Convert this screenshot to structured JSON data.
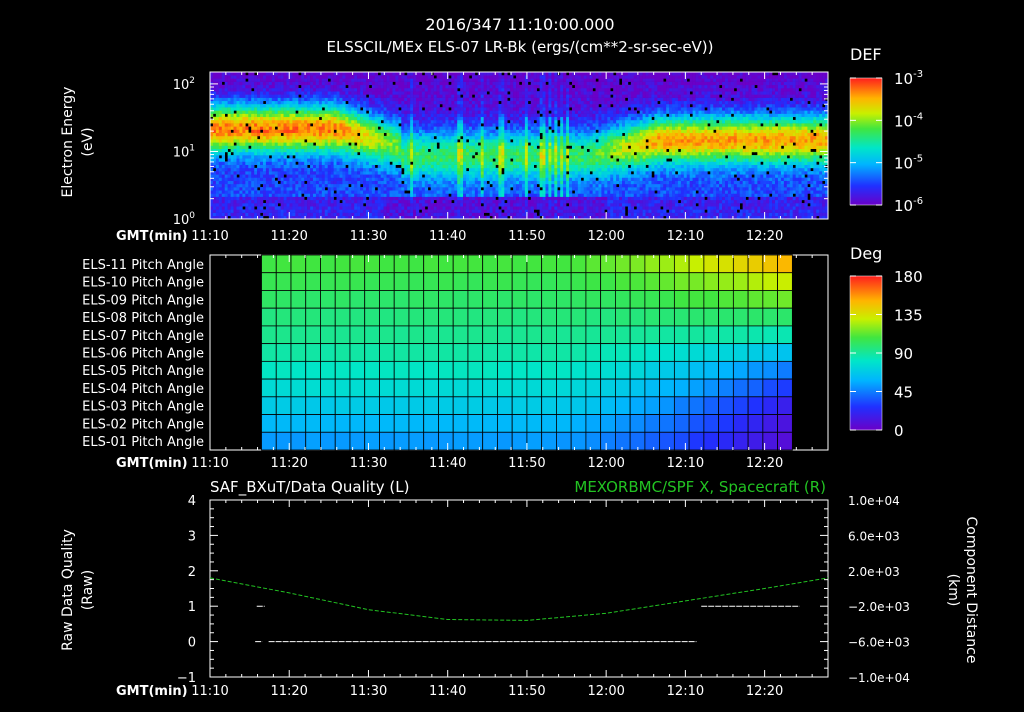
{
  "header": {
    "timestamp": "2016/347 11:10:00.000",
    "title": "ELSSCIL/MEx ELS-07 LR-Bk  (ergs/(cm**2-sr-sec-eV))"
  },
  "chart_data": [
    {
      "id": "spectrogram",
      "type": "heatmap",
      "title": "ELSSCIL/MEx ELS-07 LR-Bk  (ergs/(cm**2-sr-sec-eV))",
      "ylabel": "Electron Energy (eV)",
      "ylabel_lines": [
        "Electron Energy",
        "(eV)"
      ],
      "y_scale": "log",
      "ylim": [
        1,
        150
      ],
      "y_ticks": [
        {
          "label": "10",
          "sup": "0",
          "value": 1
        },
        {
          "label": "10",
          "sup": "1",
          "value": 10
        },
        {
          "label": "10",
          "sup": "2",
          "value": 100
        }
      ],
      "x_axis_label": "GMT(min)",
      "x_ticks": [
        "11:10",
        "11:20",
        "11:30",
        "11:40",
        "11:50",
        "12:00",
        "12:10",
        "12:20"
      ],
      "x_tick_minutes": [
        0,
        10,
        20,
        30,
        40,
        50,
        60,
        70
      ],
      "x_range_minutes": [
        0,
        78
      ],
      "colorbar": {
        "label": "DEF",
        "scale": "log",
        "range": [
          1e-06,
          0.001
        ],
        "ticks": [
          {
            "label": "10",
            "sup": "-3"
          },
          {
            "label": "10",
            "sup": "-4"
          },
          {
            "label": "10",
            "sup": "-5"
          },
          {
            "label": "10",
            "sup": "-6"
          }
        ]
      },
      "features": [
        {
          "start_min": 0,
          "end_min": 18,
          "peak_energy_eV": 20,
          "level": "high"
        },
        {
          "start_min": 23,
          "end_min": 48,
          "peak_energy_eV": 8,
          "level": "low"
        },
        {
          "start_min": 48,
          "end_min": 78,
          "peak_energy_eV": 15,
          "level": "high"
        }
      ]
    },
    {
      "id": "pitch_angle",
      "type": "heatmap",
      "rows": [
        "ELS-11 Pitch Angle",
        "ELS-10 Pitch Angle",
        "ELS-09 Pitch Angle",
        "ELS-08 Pitch Angle",
        "ELS-07 Pitch Angle",
        "ELS-06 Pitch Angle",
        "ELS-05 Pitch Angle",
        "ELS-04 Pitch Angle",
        "ELS-03 Pitch Angle",
        "ELS-02 Pitch Angle",
        "ELS-01 Pitch Angle"
      ],
      "x_axis_label": "GMT(min)",
      "x_ticks": [
        "11:10",
        "11:20",
        "11:30",
        "11:40",
        "11:50",
        "12:00",
        "12:10",
        "12:20"
      ],
      "x_tick_minutes": [
        0,
        10,
        20,
        30,
        40,
        50,
        60,
        70
      ],
      "data_range_minutes": [
        6.5,
        73.5
      ],
      "colorbar": {
        "label": "Deg",
        "range": [
          0,
          180
        ],
        "ticks": [
          "180",
          "135",
          "90",
          "45",
          "0"
        ]
      },
      "row_values_start_deg": [
        108,
        104,
        100,
        96,
        92,
        88,
        82,
        76,
        68,
        60,
        52
      ],
      "row_values_end_deg": [
        150,
        130,
        115,
        100,
        85,
        65,
        45,
        30,
        18,
        12,
        8
      ]
    },
    {
      "id": "data_quality",
      "type": "line",
      "title_left": "SAF_BXuT/Data Quality (L)",
      "title_right": "MEXORBMC/SPF X, Spacecraft (R)",
      "ylabel_left_lines": [
        "Raw Data Quality",
        "(Raw)"
      ],
      "ylabel_right_lines": [
        "Component Distance",
        "(km)"
      ],
      "ylim_left": [
        -1,
        4
      ],
      "y_ticks_left": [
        "4",
        "3",
        "2",
        "1",
        "0",
        "−1"
      ],
      "ylim_right": [
        -10000,
        10000
      ],
      "y_ticks_right": [
        "1.0e+04",
        "6.0e+03",
        "2.0e+03",
        "−2.0e+03",
        "−6.0e+03",
        "−1.0e+04"
      ],
      "x_axis_label": "GMT(min)",
      "x_ticks": [
        "11:10",
        "11:20",
        "11:30",
        "11:40",
        "11:50",
        "12:00",
        "12:10",
        "12:20"
      ],
      "x_tick_minutes": [
        0,
        10,
        20,
        30,
        40,
        50,
        60,
        70
      ],
      "series": [
        {
          "name": "SAF_BXuT/Data Quality",
          "axis": "left",
          "color": "#ffffff",
          "segments": [
            {
              "x": [
                5.9,
                6.9
              ],
              "y": [
                1,
                1
              ]
            },
            {
              "x": [
                5.7,
                6.6
              ],
              "y": [
                0,
                0
              ]
            },
            {
              "x": [
                7.4,
                61.4
              ],
              "y": [
                0,
                0
              ]
            },
            {
              "x": [
                62.0,
                74.4
              ],
              "y": [
                1,
                1
              ]
            }
          ]
        },
        {
          "name": "MEXORBMC/SPF X, Spacecraft",
          "axis": "right",
          "color": "#22c322",
          "style": "dashed",
          "x": [
            0,
            10,
            20,
            30,
            40,
            50,
            60,
            70,
            78
          ],
          "y": [
            1200,
            -500,
            -2400,
            -3500,
            -3600,
            -2800,
            -1400,
            0,
            1200
          ]
        }
      ]
    }
  ]
}
